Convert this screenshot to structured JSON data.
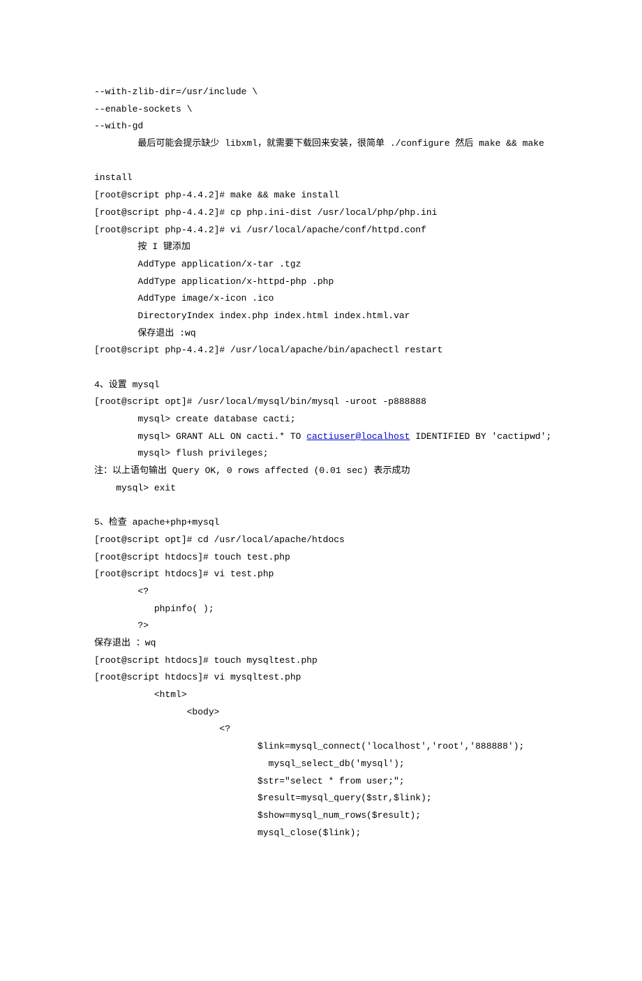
{
  "lines": [
    {
      "text": "--with-zlib-dir=/usr/include \\"
    },
    {
      "text": "--enable-sockets \\"
    },
    {
      "text": "--with-gd"
    },
    {
      "text": "        最后可能会提示缺少 libxml，就需要下载回来安装，很简单 ./configure 然后 make && make"
    },
    {
      "text": ""
    },
    {
      "text": "install"
    },
    {
      "text": "[root@script php-4.4.2]# make && make install"
    },
    {
      "text": "[root@script php-4.4.2]# cp php.ini-dist /usr/local/php/php.ini"
    },
    {
      "text": "[root@script php-4.4.2]# vi /usr/local/apache/conf/httpd.conf"
    },
    {
      "text": "        按 I 键添加"
    },
    {
      "text": "        AddType application/x-tar .tgz"
    },
    {
      "text": "        AddType application/x-httpd-php .php"
    },
    {
      "text": "        AddType image/x-icon .ico"
    },
    {
      "text": "        DirectoryIndex index.php index.html index.html.var"
    },
    {
      "text": "        保存退出 :wq"
    },
    {
      "text": "[root@script php-4.4.2]# /usr/local/apache/bin/apachectl restart"
    },
    {
      "text": ""
    },
    {
      "text": "4、设置 mysql"
    },
    {
      "text": "[root@script opt]# /usr/local/mysql/bin/mysql -uroot -p888888"
    },
    {
      "text": "        mysql> create database cacti;"
    },
    {
      "text": "        mysql> GRANT ALL ON cacti.* TO ",
      "link": "cactiuser@localhost",
      "after": " IDENTIFIED BY 'cactipwd';"
    },
    {
      "text": "        mysql> flush privileges;"
    },
    {
      "text": "注：以上语句输出 Query OK, 0 rows affected (0.01 sec) 表示成功"
    },
    {
      "text": "    mysql> exit"
    },
    {
      "text": ""
    },
    {
      "text": "5、检查 apache+php+mysql"
    },
    {
      "text": "[root@script opt]# cd /usr/local/apache/htdocs"
    },
    {
      "text": "[root@script htdocs]# touch test.php"
    },
    {
      "text": "[root@script htdocs]# vi test.php"
    },
    {
      "text": "        <?"
    },
    {
      "text": "           phpinfo( );"
    },
    {
      "text": "        ?>"
    },
    {
      "text": "保存退出 ：wq"
    },
    {
      "text": "[root@script htdocs]# touch mysqltest.php"
    },
    {
      "text": "[root@script htdocs]# vi mysqltest.php"
    },
    {
      "text": "           <html>"
    },
    {
      "text": "                 <body>"
    },
    {
      "text": "                       <?"
    },
    {
      "text": "                              $link=mysql_connect('localhost','root','888888');"
    },
    {
      "text": "                                mysql_select_db('mysql');"
    },
    {
      "text": "                              $str=\"select * from user;\";"
    },
    {
      "text": "                              $result=mysql_query($str,$link);"
    },
    {
      "text": "                              $show=mysql_num_rows($result);"
    },
    {
      "text": "                              mysql_close($link);"
    }
  ]
}
